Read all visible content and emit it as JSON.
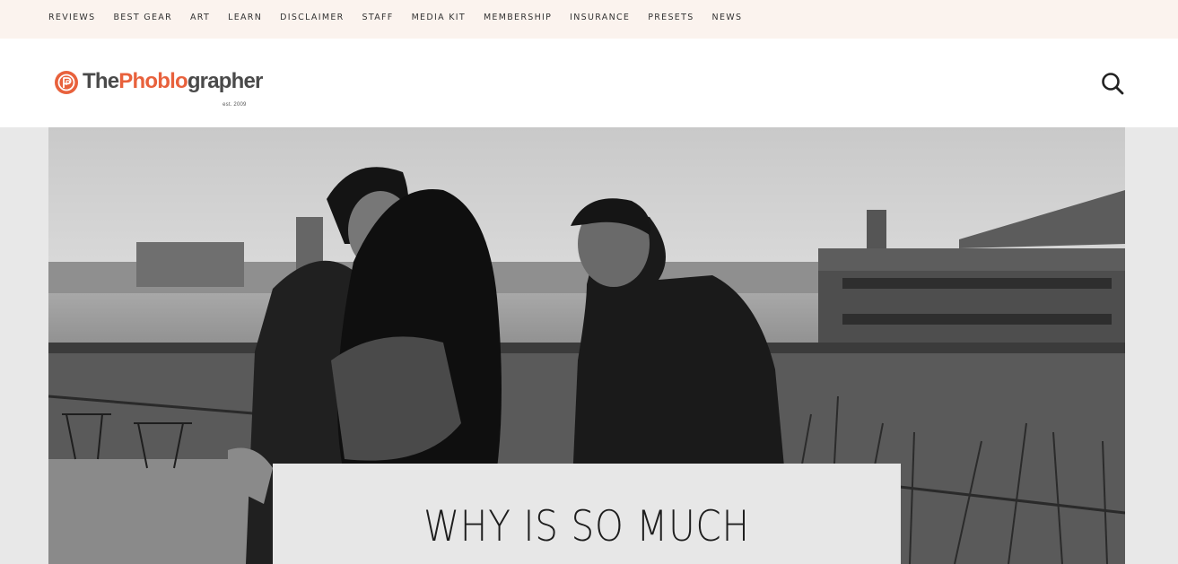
{
  "top_nav": {
    "items": [
      {
        "label": "REVIEWS"
      },
      {
        "label": "BEST GEAR"
      },
      {
        "label": "ART"
      },
      {
        "label": "LEARN"
      },
      {
        "label": "DISCLAIMER"
      },
      {
        "label": "STAFF"
      },
      {
        "label": "MEDIA KIT"
      },
      {
        "label": "MEMBERSHIP"
      },
      {
        "label": "INSURANCE"
      },
      {
        "label": "PRESETS"
      },
      {
        "label": "NEWS"
      }
    ]
  },
  "header": {
    "logo": {
      "part1": "The",
      "part2": "Phoblo",
      "part3": "grapher",
      "est": "est. 2009"
    },
    "search_icon": "search-icon"
  },
  "hero": {
    "image_icon": "photo-black-and-white-couple-waterfront"
  },
  "article": {
    "title": "WHY IS SO MUCH"
  },
  "colors": {
    "topbar_bg": "#fbf3ee",
    "brand_orange": "#e8613c",
    "logo_gray": "#4a4a4a",
    "card_bg": "#e7e7e7"
  }
}
